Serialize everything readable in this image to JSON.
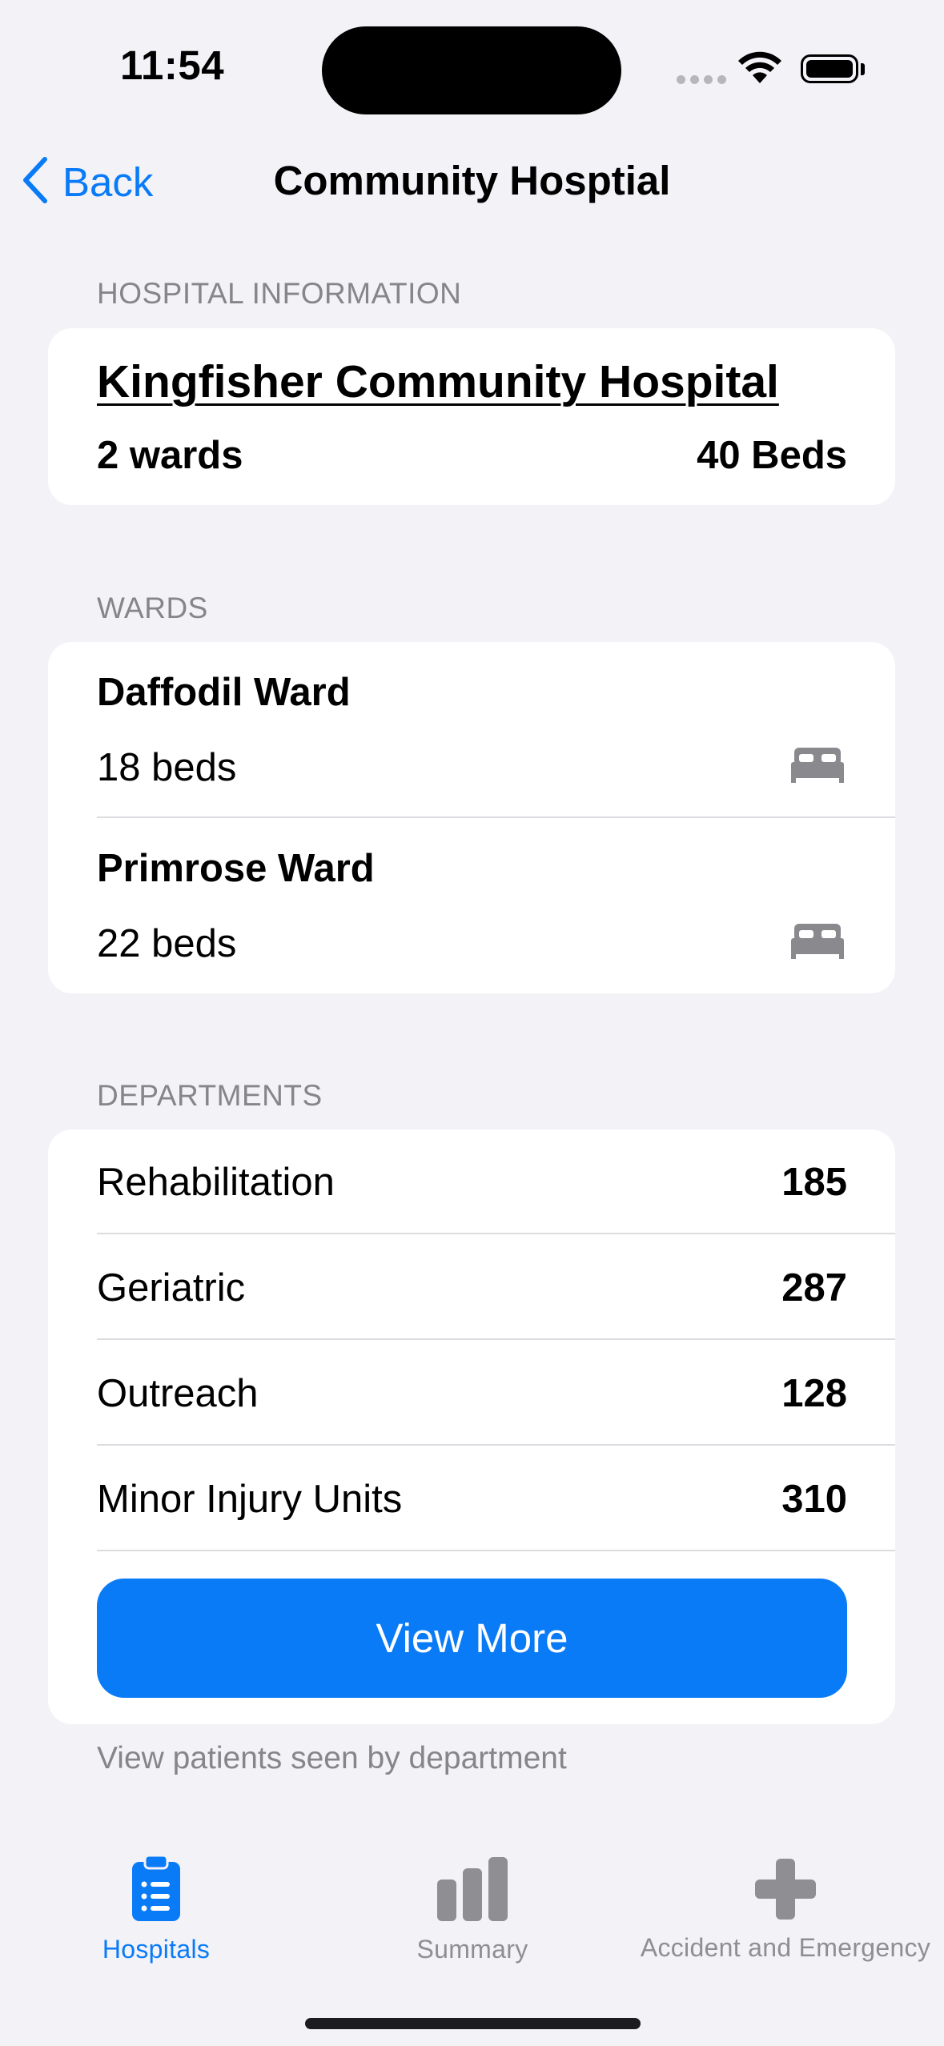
{
  "status_bar": {
    "time": "11:54"
  },
  "nav": {
    "back_label": "Back",
    "title": "Community Hosptial"
  },
  "hospital_info": {
    "header": "HOSPITAL INFORMATION",
    "name": "Kingfisher Community Hospital",
    "wards": "2 wards",
    "beds": "40 Beds"
  },
  "wards": {
    "header": "WARDS",
    "items": [
      {
        "name": "Daffodil Ward",
        "beds": "18 beds",
        "icon": "bed-icon"
      },
      {
        "name": "Primrose Ward",
        "beds": "22 beds",
        "icon": "bed-icon"
      }
    ]
  },
  "departments": {
    "header": "DEPARTMENTS",
    "items": [
      {
        "name": "Rehabilitation",
        "value": "185"
      },
      {
        "name": "Geriatric",
        "value": "287"
      },
      {
        "name": "Outreach",
        "value": "128"
      },
      {
        "name": "Minor Injury Units",
        "value": "310"
      }
    ],
    "button_label": "View More",
    "footer": "View patients seen by department"
  },
  "tab_bar": {
    "tabs": [
      {
        "label": "Hospitals",
        "icon": "clipboard-list-icon",
        "active": true
      },
      {
        "label": "Summary",
        "icon": "bar-chart-icon",
        "active": false
      },
      {
        "label": "Accident and Emergency",
        "icon": "plus-cross-icon",
        "active": false
      }
    ]
  },
  "colors": {
    "accent": "#0a7bf7",
    "background": "#f2f2f7",
    "secondary_text": "#85858a",
    "inactive_tab": "#8e8e93"
  }
}
